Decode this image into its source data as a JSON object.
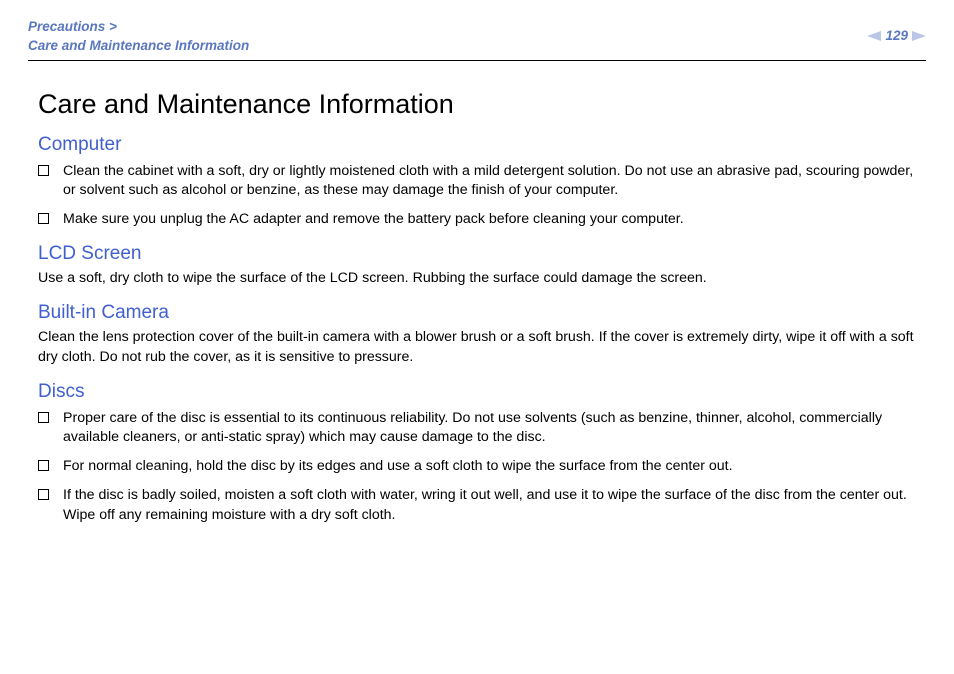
{
  "header": {
    "breadcrumb_parent": "Precautions >",
    "breadcrumb_current": "Care and Maintenance Information",
    "page_number": "129"
  },
  "main": {
    "title": "Care and Maintenance Information",
    "sections": [
      {
        "heading": "Computer",
        "items": [
          "Clean the cabinet with a soft, dry or lightly moistened cloth with a mild detergent solution. Do not use an abrasive pad, scouring powder, or solvent such as alcohol or benzine, as these may damage the finish of your computer.",
          "Make sure you unplug the AC adapter and remove the battery pack before cleaning your computer."
        ]
      },
      {
        "heading": "LCD Screen",
        "paragraph": "Use a soft, dry cloth to wipe the surface of the LCD screen. Rubbing the surface could damage the screen."
      },
      {
        "heading": "Built-in Camera",
        "paragraph": "Clean the lens protection cover of the built-in camera with a blower brush or a soft brush. If the cover is extremely dirty, wipe it off with a soft dry cloth. Do not rub the cover, as it is sensitive to pressure."
      },
      {
        "heading": "Discs",
        "items": [
          "Proper care of the disc is essential to its continuous reliability. Do not use solvents (such as benzine, thinner, alcohol, commercially available cleaners, or anti-static spray) which may cause damage to the disc.",
          "For normal cleaning, hold the disc by its edges and use a soft cloth to wipe the surface from the center out.",
          "If the disc is badly soiled, moisten a soft cloth with water, wring it out well, and use it to wipe the surface of the disc from the center out. Wipe off any remaining moisture with a dry soft cloth."
        ]
      }
    ]
  }
}
